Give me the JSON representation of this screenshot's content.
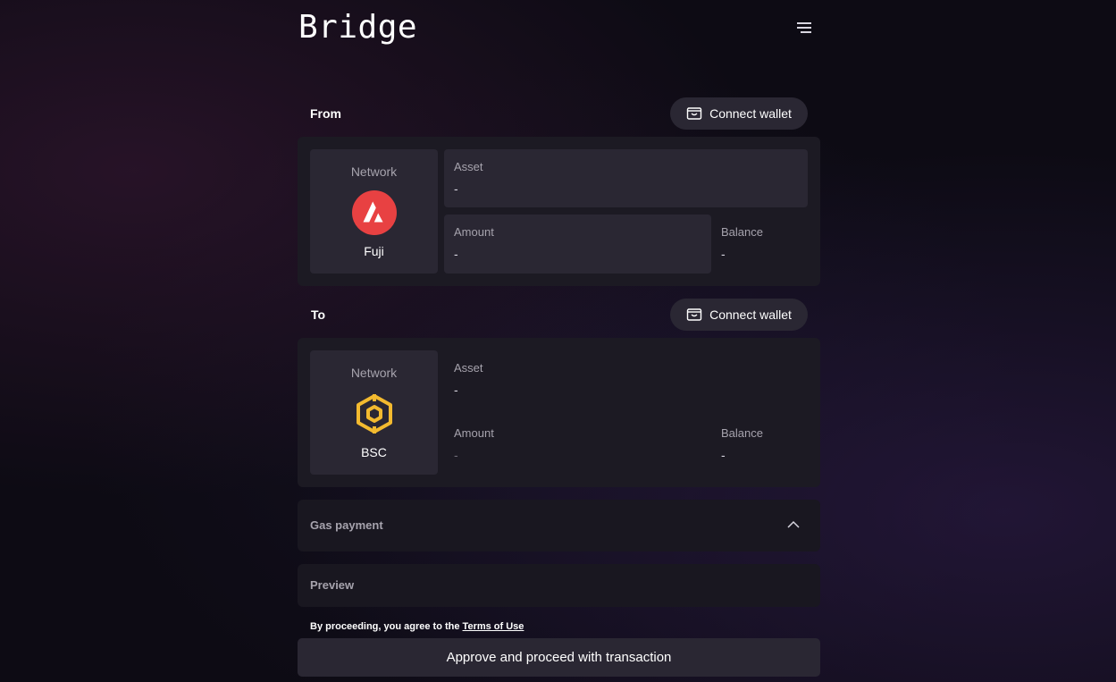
{
  "header": {
    "title": "Bridge",
    "menu_icon": "hamburger-menu-icon"
  },
  "from": {
    "label": "From",
    "connect_label": "Connect wallet",
    "network_label": "Network",
    "network_name": "Fuji",
    "network_icon": "avalanche-logo-icon",
    "asset_label": "Asset",
    "asset_value": "-",
    "amount_label": "Amount",
    "amount_value": "-",
    "balance_label": "Balance",
    "balance_value": "-"
  },
  "to": {
    "label": "To",
    "connect_label": "Connect wallet",
    "network_label": "Network",
    "network_name": "BSC",
    "network_icon": "bnb-logo-icon",
    "asset_label": "Asset",
    "asset_value": "-",
    "amount_label": "Amount",
    "amount_value": "-",
    "balance_label": "Balance",
    "balance_value": "-"
  },
  "gas": {
    "label": "Gas payment",
    "icon": "chevron-up-icon"
  },
  "preview": {
    "label": "Preview"
  },
  "terms": {
    "prefix": "By proceeding, you agree to the",
    "link": "Terms of Use"
  },
  "approve": {
    "label": "Approve and proceed with transaction"
  },
  "colors": {
    "avalanche_red": "#e84142",
    "bnb_yellow": "#f3ba2f",
    "panel": "#1c1a23",
    "surface": "#2a2733"
  }
}
